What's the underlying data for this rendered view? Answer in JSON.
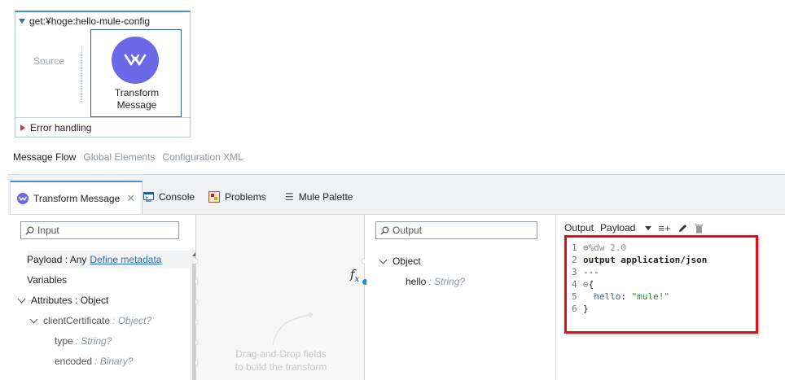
{
  "flow": {
    "title": "get:¥hoge:hello-mule-config",
    "source_label": "Source",
    "component_label": "Transform\nMessage",
    "error_handling": "Error handling"
  },
  "editor_tabs": [
    {
      "label": "Message Flow"
    },
    {
      "label": "Global Elements"
    },
    {
      "label": "Configuration XML"
    }
  ],
  "panel_tabs": [
    {
      "label": "Transform Message"
    },
    {
      "label": "Console"
    },
    {
      "label": "Problems"
    },
    {
      "label": "Mule Palette"
    }
  ],
  "input": {
    "placeholder": "Input",
    "payload_label": "Payload : Any",
    "define_metadata": "Define metadata",
    "variables": "Variables",
    "attributes": "Attributes : Object",
    "client_certificate": "clientCertificate",
    "client_certificate_type": ": Object?",
    "type_field": "type",
    "type_field_type": ": String?",
    "encoded_field": "encoded",
    "encoded_field_type": ": Binary?"
  },
  "mapping": {
    "drag_hint": "Drag-and-Drop fields\nto build the transform",
    "fx": "fx"
  },
  "output": {
    "placeholder": "Output",
    "object": "Object",
    "hello_field": "hello",
    "hello_type": ": String?"
  },
  "script": {
    "output_label": "Output",
    "target_label": "Payload",
    "lines": [
      {
        "n": "1",
        "fold": "⊖",
        "text": "%dw 2.0"
      },
      {
        "n": "2",
        "fold": "",
        "text": "output application/json"
      },
      {
        "n": "3",
        "fold": "",
        "text": "---"
      },
      {
        "n": "4",
        "fold": "⊖",
        "text": "{"
      },
      {
        "n": "5",
        "fold": "",
        "key": "hello",
        "sep": ": ",
        "value": "\"mule!\""
      },
      {
        "n": "6",
        "fold": "",
        "text": "}"
      }
    ]
  },
  "colors": {
    "accent": "#3d8fd6",
    "transform_icon": "#6d68e8",
    "highlight_border": "#d2141e"
  }
}
